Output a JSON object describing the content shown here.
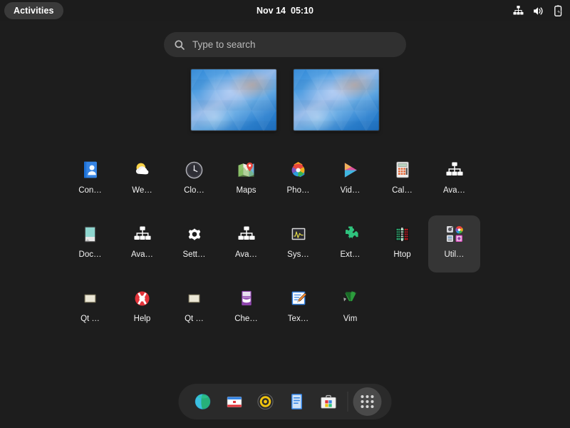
{
  "topbar": {
    "activities_label": "Activities",
    "clock": {
      "date": "Nov 14",
      "time": "05:10"
    },
    "status_icons": [
      {
        "name": "network-wired-icon",
        "label": "Network"
      },
      {
        "name": "volume-icon",
        "label": "Volume"
      },
      {
        "name": "battery-charging-icon",
        "label": "Battery charging"
      }
    ]
  },
  "search": {
    "placeholder": "Type to search",
    "value": "",
    "icon": "search-icon"
  },
  "workspaces": {
    "count": 2,
    "items": [
      {
        "index": 1,
        "active": true
      },
      {
        "index": 2,
        "active": false
      }
    ]
  },
  "app_grid": {
    "rows": [
      [
        {
          "label": "Con…",
          "full": "Contacts",
          "icon": "contacts-icon",
          "selected": false
        },
        {
          "label": "We…",
          "full": "Weather",
          "icon": "weather-icon",
          "selected": false
        },
        {
          "label": "Clo…",
          "full": "Clocks",
          "icon": "clocks-icon",
          "selected": false
        },
        {
          "label": "Maps",
          "full": "Maps",
          "icon": "maps-icon",
          "selected": false
        },
        {
          "label": "Pho…",
          "full": "Photos",
          "icon": "photos-icon",
          "selected": false
        },
        {
          "label": "Vid…",
          "full": "Videos",
          "icon": "videos-icon",
          "selected": false
        },
        {
          "label": "Cal…",
          "full": "Calculator",
          "icon": "calculator-icon",
          "selected": false
        },
        {
          "label": "Ava…",
          "full": "Avahi Zeroconf Browser",
          "icon": "avahi-icon",
          "selected": false
        }
      ],
      [
        {
          "label": "Doc…",
          "full": "Documents",
          "icon": "documents-icon",
          "selected": false
        },
        {
          "label": "Ava…",
          "full": "Avahi SSH Server Browser",
          "icon": "avahi-icon",
          "selected": false
        },
        {
          "label": "Sett…",
          "full": "Settings",
          "icon": "settings-icon",
          "selected": false
        },
        {
          "label": "Ava…",
          "full": "Avahi VNC Server Browser",
          "icon": "avahi-icon",
          "selected": false
        },
        {
          "label": "Sys…",
          "full": "System Monitor",
          "icon": "system-monitor-icon",
          "selected": false
        },
        {
          "label": "Ext…",
          "full": "Extensions",
          "icon": "extensions-icon",
          "selected": false
        },
        {
          "label": "Htop",
          "full": "Htop",
          "icon": "htop-icon",
          "selected": false
        },
        {
          "label": "Util…",
          "full": "Utilities",
          "icon": "utilities-folder-icon",
          "selected": true
        }
      ],
      [
        {
          "label": "Qt …",
          "full": "Qt Assistant",
          "icon": "qt-window-icon",
          "selected": false
        },
        {
          "label": "Help",
          "full": "Help",
          "icon": "help-icon",
          "selected": false
        },
        {
          "label": "Qt …",
          "full": "Qt Designer",
          "icon": "qt-window-icon",
          "selected": false
        },
        {
          "label": "Che…",
          "full": "Cheese",
          "icon": "cheese-icon",
          "selected": false
        },
        {
          "label": "Tex…",
          "full": "Text Editor",
          "icon": "text-editor-icon",
          "selected": false
        },
        {
          "label": "Vim",
          "full": "Vim",
          "icon": "vim-icon",
          "selected": false
        }
      ]
    ]
  },
  "dash": {
    "items": [
      {
        "name": "dash-web-browser",
        "label": "Web",
        "icon": "globe-icon"
      },
      {
        "name": "dash-mail",
        "label": "Mail",
        "icon": "mail-icon"
      },
      {
        "name": "dash-music",
        "label": "Rhythmbox",
        "icon": "music-icon"
      },
      {
        "name": "dash-text-editor",
        "label": "Text Editor",
        "icon": "document-icon"
      },
      {
        "name": "dash-software",
        "label": "Software",
        "icon": "software-icon"
      }
    ],
    "show_apps_label": "Show Applications",
    "show_apps_icon": "grid-dots-icon"
  },
  "colors": {
    "background": "#1d1d1d",
    "topbar": "#1c1c1c",
    "search_bg": "#303030",
    "dash_bg": "#2a2a2a",
    "selected_bg": "#353535",
    "text": "#ffffff",
    "muted_text": "#b9b9b9"
  }
}
